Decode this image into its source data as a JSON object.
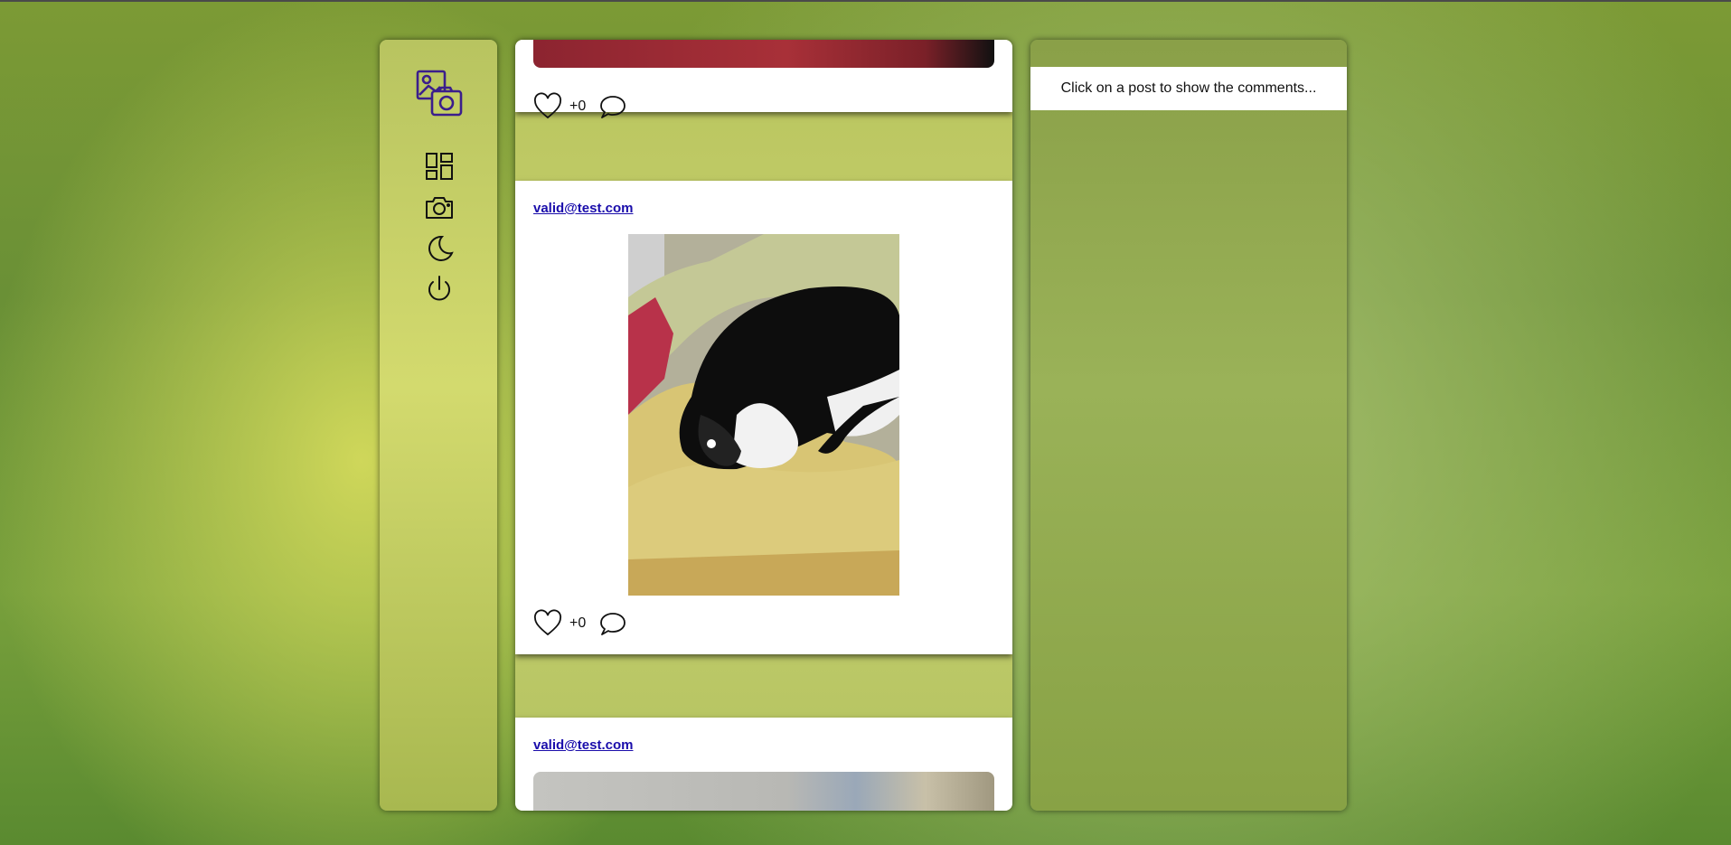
{
  "sidebar": {
    "logo": "photo-gallery-logo-icon",
    "nav": [
      {
        "name": "dashboard-icon"
      },
      {
        "name": "camera-icon"
      },
      {
        "name": "dark-mode-moon-icon"
      },
      {
        "name": "power-logout-icon"
      }
    ],
    "accent_color": "#3b1e8c"
  },
  "feed": {
    "posts": [
      {
        "author": "",
        "likes": "+0"
      },
      {
        "author": "valid@test.com",
        "likes": "+0"
      },
      {
        "author": "valid@test.com",
        "likes": ""
      }
    ]
  },
  "comments_panel": {
    "hint": "Click on a post to show the comments..."
  }
}
